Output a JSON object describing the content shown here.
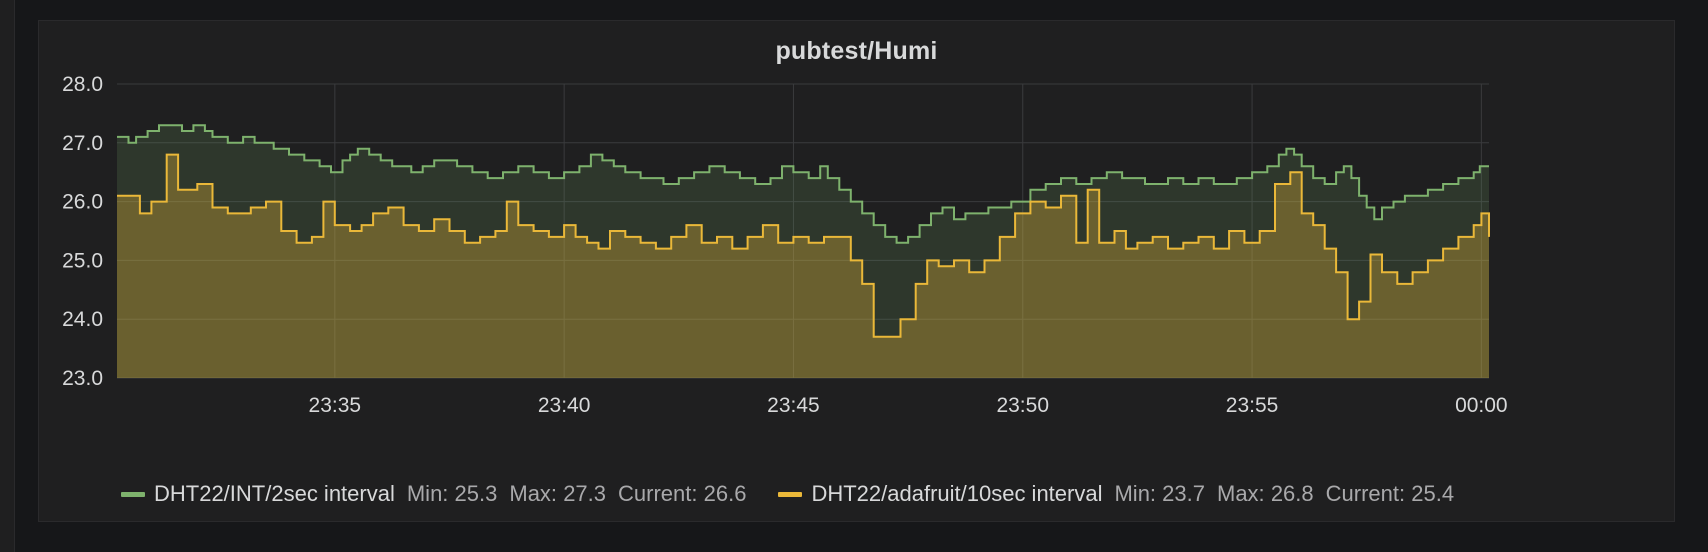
{
  "panel": {
    "title": "pubtest/Humi"
  },
  "colors": {
    "background": "#161719",
    "panel": "#1f1f20",
    "grid": "#3a3b3d",
    "text": "#d8d9da",
    "series_int": "#7eb26d",
    "series_ada": "#eab839"
  },
  "chart_data": {
    "type": "line",
    "fill": "area",
    "step": true,
    "title": "pubtest/Humi",
    "xlabel": "",
    "ylabel": "",
    "ylim": [
      23.0,
      28.0
    ],
    "yticks": [
      "23.0",
      "24.0",
      "25.0",
      "26.0",
      "27.0",
      "28.0"
    ],
    "xticks": [
      "23:35",
      "23:40",
      "23:45",
      "23:50",
      "23:55",
      "00:00"
    ],
    "xlim": [
      "23:30:15",
      "00:00:10"
    ],
    "grid": true,
    "legend_position": "bottom",
    "series": [
      {
        "name": "DHT22/INT/2sec interval",
        "color": "#7eb26d",
        "legend": {
          "min_label": "Min:",
          "min": "25.3",
          "max_label": "Max:",
          "max": "27.3",
          "current_label": "Current:",
          "current": "26.6"
        },
        "points": [
          [
            "23:30:15",
            27.1
          ],
          [
            "23:30:30",
            27.0
          ],
          [
            "23:30:40",
            27.1
          ],
          [
            "23:30:55",
            27.2
          ],
          [
            "23:31:10",
            27.3
          ],
          [
            "23:31:40",
            27.2
          ],
          [
            "23:31:55",
            27.3
          ],
          [
            "23:32:10",
            27.2
          ],
          [
            "23:32:20",
            27.1
          ],
          [
            "23:32:40",
            27.0
          ],
          [
            "23:33:00",
            27.1
          ],
          [
            "23:33:15",
            27.0
          ],
          [
            "23:33:40",
            26.9
          ],
          [
            "23:34:00",
            26.8
          ],
          [
            "23:34:20",
            26.7
          ],
          [
            "23:34:40",
            26.6
          ],
          [
            "23:34:55",
            26.5
          ],
          [
            "23:35:10",
            26.7
          ],
          [
            "23:35:20",
            26.8
          ],
          [
            "23:35:30",
            26.9
          ],
          [
            "23:35:45",
            26.8
          ],
          [
            "23:36:00",
            26.7
          ],
          [
            "23:36:15",
            26.6
          ],
          [
            "23:36:40",
            26.5
          ],
          [
            "23:36:55",
            26.6
          ],
          [
            "23:37:10",
            26.7
          ],
          [
            "23:37:40",
            26.6
          ],
          [
            "23:38:00",
            26.5
          ],
          [
            "23:38:20",
            26.4
          ],
          [
            "23:38:40",
            26.5
          ],
          [
            "23:39:00",
            26.6
          ],
          [
            "23:39:20",
            26.5
          ],
          [
            "23:39:40",
            26.4
          ],
          [
            "23:40:00",
            26.5
          ],
          [
            "23:40:20",
            26.6
          ],
          [
            "23:40:35",
            26.8
          ],
          [
            "23:40:50",
            26.7
          ],
          [
            "23:41:05",
            26.6
          ],
          [
            "23:41:20",
            26.5
          ],
          [
            "23:41:40",
            26.4
          ],
          [
            "23:42:10",
            26.3
          ],
          [
            "23:42:30",
            26.4
          ],
          [
            "23:42:50",
            26.5
          ],
          [
            "23:43:10",
            26.6
          ],
          [
            "23:43:30",
            26.5
          ],
          [
            "23:43:50",
            26.4
          ],
          [
            "23:44:10",
            26.3
          ],
          [
            "23:44:30",
            26.4
          ],
          [
            "23:44:45",
            26.6
          ],
          [
            "23:45:00",
            26.5
          ],
          [
            "23:45:20",
            26.4
          ],
          [
            "23:45:35",
            26.6
          ],
          [
            "23:45:45",
            26.4
          ],
          [
            "23:46:00",
            26.2
          ],
          [
            "23:46:15",
            26.0
          ],
          [
            "23:46:30",
            25.8
          ],
          [
            "23:46:45",
            25.6
          ],
          [
            "23:47:00",
            25.4
          ],
          [
            "23:47:15",
            25.3
          ],
          [
            "23:47:30",
            25.4
          ],
          [
            "23:47:45",
            25.6
          ],
          [
            "23:48:00",
            25.8
          ],
          [
            "23:48:15",
            25.9
          ],
          [
            "23:48:30",
            25.7
          ],
          [
            "23:48:45",
            25.8
          ],
          [
            "23:49:15",
            25.9
          ],
          [
            "23:49:45",
            26.0
          ],
          [
            "23:50:10",
            26.2
          ],
          [
            "23:50:30",
            26.3
          ],
          [
            "23:50:50",
            26.4
          ],
          [
            "23:51:10",
            26.3
          ],
          [
            "23:51:30",
            26.4
          ],
          [
            "23:51:50",
            26.5
          ],
          [
            "23:52:10",
            26.4
          ],
          [
            "23:52:40",
            26.3
          ],
          [
            "23:53:10",
            26.4
          ],
          [
            "23:53:30",
            26.3
          ],
          [
            "23:53:50",
            26.4
          ],
          [
            "23:54:10",
            26.3
          ],
          [
            "23:54:40",
            26.4
          ],
          [
            "23:55:00",
            26.5
          ],
          [
            "23:55:20",
            26.6
          ],
          [
            "23:55:35",
            26.8
          ],
          [
            "23:55:45",
            26.9
          ],
          [
            "23:55:55",
            26.8
          ],
          [
            "23:56:05",
            26.6
          ],
          [
            "23:56:20",
            26.4
          ],
          [
            "23:56:35",
            26.3
          ],
          [
            "23:56:50",
            26.5
          ],
          [
            "23:57:00",
            26.6
          ],
          [
            "23:57:10",
            26.4
          ],
          [
            "23:57:20",
            26.1
          ],
          [
            "23:57:30",
            25.9
          ],
          [
            "23:57:40",
            25.7
          ],
          [
            "23:57:50",
            25.9
          ],
          [
            "23:58:05",
            26.0
          ],
          [
            "23:58:20",
            26.1
          ],
          [
            "23:58:50",
            26.2
          ],
          [
            "23:59:10",
            26.3
          ],
          [
            "23:59:30",
            26.4
          ],
          [
            "23:59:50",
            26.5
          ],
          [
            "23:59:58",
            26.6
          ],
          [
            "00:00:10",
            26.6
          ]
        ]
      },
      {
        "name": "DHT22/adafruit/10sec interval",
        "color": "#eab839",
        "legend": {
          "min_label": "Min:",
          "min": "23.7",
          "max_label": "Max:",
          "max": "26.8",
          "current_label": "Current:",
          "current": "25.4"
        },
        "points": [
          [
            "23:30:15",
            26.1
          ],
          [
            "23:30:45",
            25.8
          ],
          [
            "23:31:00",
            26.0
          ],
          [
            "23:31:20",
            26.8
          ],
          [
            "23:31:35",
            26.2
          ],
          [
            "23:32:00",
            26.3
          ],
          [
            "23:32:20",
            25.9
          ],
          [
            "23:32:40",
            25.8
          ],
          [
            "23:33:10",
            25.9
          ],
          [
            "23:33:30",
            26.0
          ],
          [
            "23:33:50",
            25.5
          ],
          [
            "23:34:10",
            25.3
          ],
          [
            "23:34:30",
            25.4
          ],
          [
            "23:34:45",
            26.0
          ],
          [
            "23:35:00",
            25.6
          ],
          [
            "23:35:20",
            25.5
          ],
          [
            "23:35:35",
            25.6
          ],
          [
            "23:35:50",
            25.8
          ],
          [
            "23:36:10",
            25.9
          ],
          [
            "23:36:30",
            25.6
          ],
          [
            "23:36:50",
            25.5
          ],
          [
            "23:37:10",
            25.7
          ],
          [
            "23:37:30",
            25.5
          ],
          [
            "23:37:50",
            25.3
          ],
          [
            "23:38:10",
            25.4
          ],
          [
            "23:38:30",
            25.5
          ],
          [
            "23:38:45",
            26.0
          ],
          [
            "23:39:00",
            25.6
          ],
          [
            "23:39:20",
            25.5
          ],
          [
            "23:39:40",
            25.4
          ],
          [
            "23:40:00",
            25.6
          ],
          [
            "23:40:15",
            25.4
          ],
          [
            "23:40:30",
            25.3
          ],
          [
            "23:40:45",
            25.2
          ],
          [
            "23:41:00",
            25.5
          ],
          [
            "23:41:20",
            25.4
          ],
          [
            "23:41:40",
            25.3
          ],
          [
            "23:42:00",
            25.2
          ],
          [
            "23:42:20",
            25.4
          ],
          [
            "23:42:40",
            25.6
          ],
          [
            "23:43:00",
            25.3
          ],
          [
            "23:43:20",
            25.4
          ],
          [
            "23:43:40",
            25.2
          ],
          [
            "23:44:00",
            25.4
          ],
          [
            "23:44:20",
            25.6
          ],
          [
            "23:44:40",
            25.3
          ],
          [
            "23:45:00",
            25.4
          ],
          [
            "23:45:20",
            25.3
          ],
          [
            "23:45:40",
            25.4
          ],
          [
            "23:46:00",
            25.4
          ],
          [
            "23:46:15",
            25.0
          ],
          [
            "23:46:30",
            24.6
          ],
          [
            "23:46:45",
            23.7
          ],
          [
            "23:47:00",
            23.7
          ],
          [
            "23:47:20",
            24.0
          ],
          [
            "23:47:40",
            24.6
          ],
          [
            "23:47:55",
            25.0
          ],
          [
            "23:48:10",
            24.9
          ],
          [
            "23:48:30",
            25.0
          ],
          [
            "23:48:50",
            24.8
          ],
          [
            "23:49:10",
            25.0
          ],
          [
            "23:49:30",
            25.4
          ],
          [
            "23:49:50",
            25.8
          ],
          [
            "23:50:10",
            26.0
          ],
          [
            "23:50:30",
            25.9
          ],
          [
            "23:50:50",
            26.1
          ],
          [
            "23:51:10",
            25.3
          ],
          [
            "23:51:25",
            26.2
          ],
          [
            "23:51:40",
            25.3
          ],
          [
            "23:52:00",
            25.5
          ],
          [
            "23:52:15",
            25.2
          ],
          [
            "23:52:30",
            25.3
          ],
          [
            "23:52:50",
            25.4
          ],
          [
            "23:53:10",
            25.2
          ],
          [
            "23:53:30",
            25.3
          ],
          [
            "23:53:50",
            25.4
          ],
          [
            "23:54:10",
            25.2
          ],
          [
            "23:54:30",
            25.5
          ],
          [
            "23:54:50",
            25.3
          ],
          [
            "23:55:10",
            25.5
          ],
          [
            "23:55:30",
            26.3
          ],
          [
            "23:55:50",
            26.5
          ],
          [
            "23:56:05",
            25.8
          ],
          [
            "23:56:20",
            25.6
          ],
          [
            "23:56:35",
            25.2
          ],
          [
            "23:56:50",
            24.8
          ],
          [
            "23:57:05",
            24.0
          ],
          [
            "23:57:20",
            24.3
          ],
          [
            "23:57:35",
            25.1
          ],
          [
            "23:57:50",
            24.8
          ],
          [
            "23:58:10",
            24.6
          ],
          [
            "23:58:30",
            24.8
          ],
          [
            "23:58:50",
            25.0
          ],
          [
            "23:59:10",
            25.2
          ],
          [
            "23:59:30",
            25.4
          ],
          [
            "23:59:50",
            25.6
          ],
          [
            "00:00:00",
            25.8
          ],
          [
            "00:00:10",
            25.4
          ]
        ]
      }
    ]
  }
}
